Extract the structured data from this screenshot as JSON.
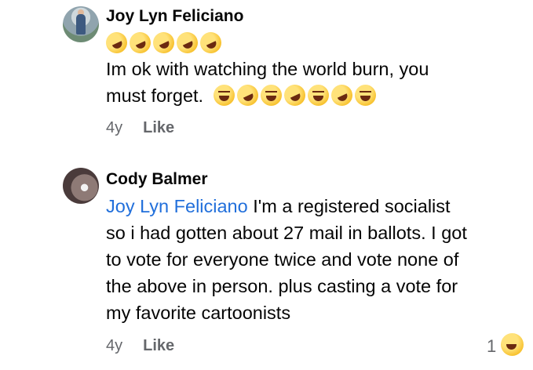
{
  "comments": [
    {
      "author": "Joy Lyn Feliciano",
      "emoji_line": [
        "rofl-emoji",
        "rofl-emoji",
        "rofl-emoji",
        "rofl-emoji",
        "rofl-emoji"
      ],
      "text_line1": "Im ok with watching the world burn, you",
      "text_line2": "must forget.",
      "text_emojis": [
        "laughing-emoji",
        "rofl-emoji",
        "joy-emoji",
        "rofl-emoji",
        "laughing-emoji",
        "rofl-emoji",
        "joy-emoji"
      ],
      "time": "4y",
      "like_label": "Like"
    },
    {
      "author": "Cody Balmer",
      "mention": "Joy Lyn Feliciano",
      "text_lines": [
        " I'm a registered socialist",
        "so i had gotten about 27 mail in ballots. I got",
        "to vote for everyone twice and vote none of",
        "the above in person. plus casting a vote for",
        "my favorite cartoonists"
      ],
      "time": "4y",
      "like_label": "Like",
      "reaction_count": "1",
      "reaction_icon": "haha-reaction-icon"
    }
  ]
}
